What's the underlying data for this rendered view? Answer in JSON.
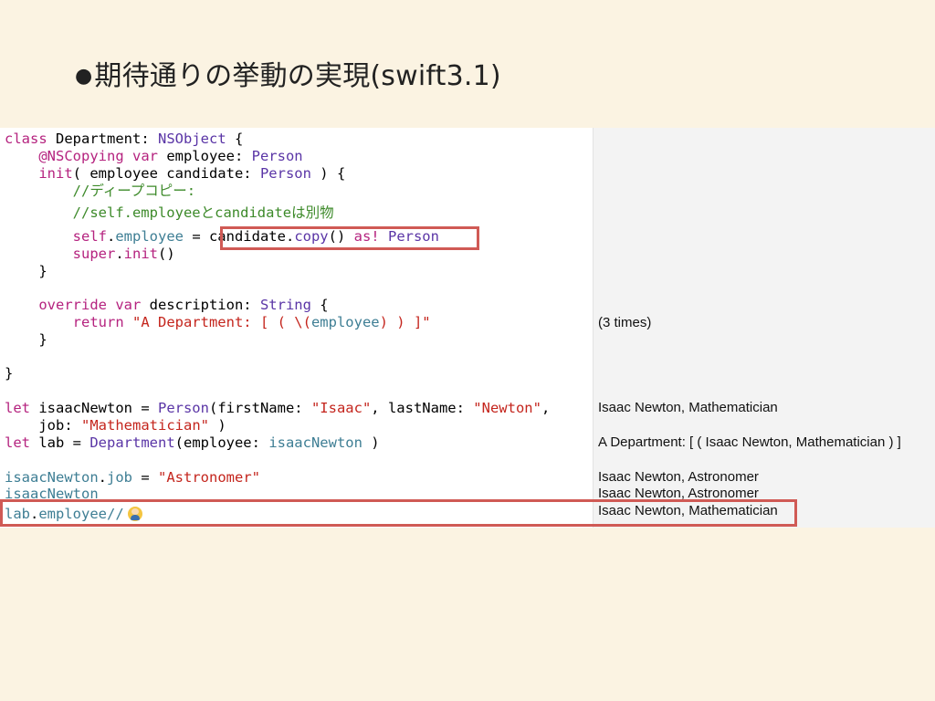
{
  "slide": {
    "bullet": "●",
    "title": "期待通りの挙動の実現(swift3.1)"
  },
  "code": {
    "l1": {
      "a": "class",
      "b": " Department: ",
      "c": "NSObject",
      "d": " {"
    },
    "l2": {
      "a": "    @NSCopying",
      "b": " var",
      "c": " employee: ",
      "d": "Person"
    },
    "l3": {
      "a": "    init",
      "b": "( employee candidate: ",
      "c": "Person",
      "d": " ) {"
    },
    "l4": {
      "a": "        //ディープコピー:"
    },
    "l5": {
      "a": "        //self.employeeとcandidateは別物"
    },
    "l6": {
      "a": "        self",
      "b": ".",
      "c": "employee",
      "d": " = candidate.",
      "e": "copy",
      "f": "() ",
      "g": "as!",
      "h": " ",
      "i": "Person"
    },
    "l7": {
      "a": "        super",
      "b": ".",
      "c": "init",
      "d": "()"
    },
    "l8": {
      "a": "    }"
    },
    "l9": {
      "a": "    override",
      "b": " var",
      "c": " description: ",
      "d": "String",
      "e": " {"
    },
    "l10": {
      "a": "        return",
      "b": " \"A Department: [ ( \\(",
      "c": "employee",
      "d": ") ) ]\""
    },
    "l11": {
      "a": "    }"
    },
    "l12": {
      "a": "}"
    },
    "l13": {
      "a": "let",
      "b": " isaacNewton = ",
      "c": "Person",
      "d": "(firstName: ",
      "e": "\"Isaac\"",
      "f": ", lastName: ",
      "g": "\"Newton\"",
      "h": ","
    },
    "l14": {
      "a": "    job: ",
      "b": "\"Mathematician\"",
      "c": " )"
    },
    "l15": {
      "a": "let",
      "b": " lab = ",
      "c": "Department",
      "d": "(employee: ",
      "e": "isaacNewton",
      "f": " )"
    },
    "l16": {
      "a": "isaacNewton",
      "b": ".",
      "c": "job",
      "d": " = ",
      "e": "\"Astronomer\""
    },
    "l17": {
      "a": "isaacNewton"
    },
    "l18": {
      "a": "lab",
      "b": ".",
      "c": "employee",
      "d": "//"
    }
  },
  "results": {
    "r1": "(3 times)",
    "r2": "Isaac Newton, Mathematician",
    "r3": "A Department: [ ( Isaac Newton, Mathematician ) ]",
    "r4": "Isaac Newton, Astronomer",
    "r5": "Isaac Newton, Astronomer",
    "r6": "Isaac Newton, Mathematician"
  },
  "icons": {
    "person": "person-emoji-icon"
  },
  "colors": {
    "background": "#fbf3e2",
    "highlight": "#d05a55",
    "keyword": "#b5237f",
    "type": "#5a35a6",
    "string": "#c4251d",
    "comment": "#3d8a2a",
    "property": "#3e7e94"
  }
}
